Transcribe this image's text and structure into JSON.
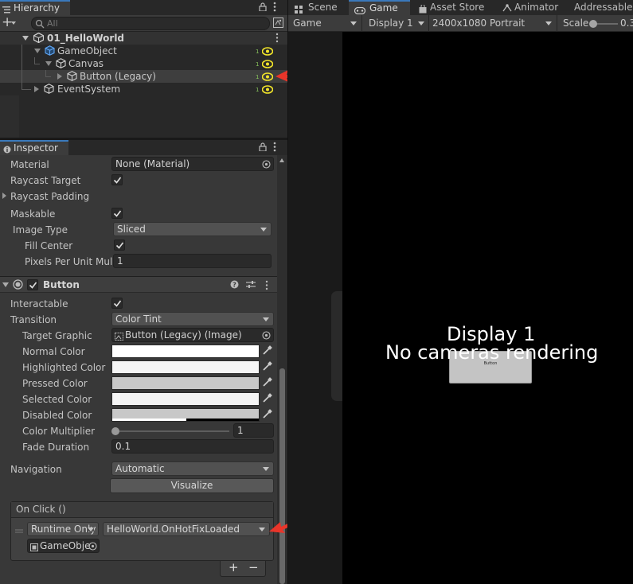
{
  "hierarchy": {
    "tab_label": "Hierarchy",
    "add_label": "+",
    "search_placeholder": "All",
    "scene_name": "01_HelloWorld",
    "items": [
      {
        "label": "GameObject"
      },
      {
        "label": "Canvas"
      },
      {
        "label": "Button (Legacy)"
      },
      {
        "label": "EventSystem"
      }
    ]
  },
  "inspector": {
    "tab_label": "Inspector",
    "image_section": {
      "material_label": "Material",
      "material_value": "None (Material)",
      "raycast_target_label": "Raycast Target",
      "raycast_padding_label": "Raycast Padding",
      "maskable_label": "Maskable",
      "image_type_label": "Image Type",
      "image_type_value": "Sliced",
      "fill_center_label": "Fill Center",
      "ppu_label": "Pixels Per Unit Mult",
      "ppu_value": "1"
    },
    "button_component": {
      "title": "Button",
      "interactable_label": "Interactable",
      "transition_label": "Transition",
      "transition_value": "Color Tint",
      "target_graphic_label": "Target Graphic",
      "target_graphic_value": "Button (Legacy) (Image)",
      "colors": [
        {
          "label": "Normal Color",
          "value": "#ffffff"
        },
        {
          "label": "Highlighted Color",
          "value": "#f5f5f5"
        },
        {
          "label": "Pressed Color",
          "value": "#c8c8c8"
        },
        {
          "label": "Selected Color",
          "value": "#f5f5f5"
        },
        {
          "label": "Disabled Color",
          "value": "#c8c8c8"
        }
      ],
      "color_multiplier_label": "Color Multiplier",
      "color_multiplier_value": "1",
      "fade_duration_label": "Fade Duration",
      "fade_duration_value": "0.1",
      "navigation_label": "Navigation",
      "navigation_value": "Automatic",
      "visualize_label": "Visualize",
      "onclick_label": "On Click ()",
      "runtime_value": "Runtime Only",
      "function_value": "HelloWorld.OnHotFixLoaded",
      "object_value": "GameObje",
      "add_label": "+",
      "remove_label": "−"
    }
  },
  "tabs": [
    {
      "label": "Scene"
    },
    {
      "label": "Game"
    },
    {
      "label": "Asset Store"
    },
    {
      "label": "Animator"
    },
    {
      "label": "Addressables"
    }
  ],
  "game_toolbar": {
    "mode_value": "Game",
    "display_value": "Display 1",
    "resolution_value": "2400x1080 Portrait",
    "scale_label": "Scale",
    "scale_value": "0.3"
  },
  "game_view": {
    "display_text": "Display 1",
    "message": "No cameras rendering",
    "button_text": "Button"
  },
  "colors": {
    "accent": "#3a79bb",
    "eye_icon": "#f2e52a",
    "annotation_arrow": "#e8352a"
  }
}
